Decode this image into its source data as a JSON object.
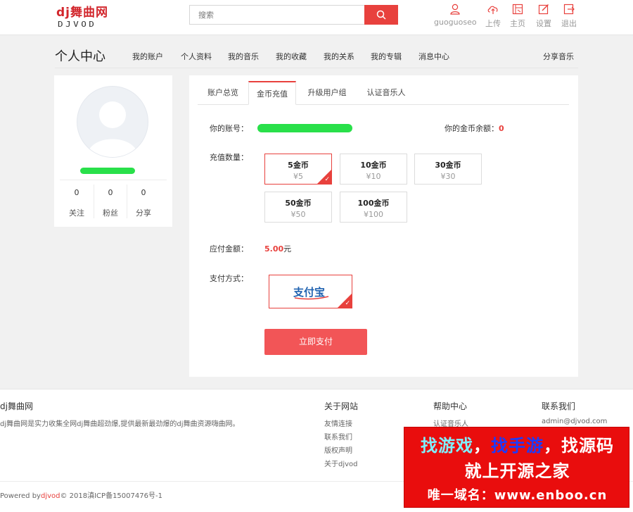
{
  "header": {
    "logo_line1": "dj舞曲网",
    "logo_line2": "DJVOD",
    "search_placeholder": "搜索",
    "username": "guoguoseo",
    "nav": [
      "上传",
      "主页",
      "设置",
      "退出"
    ]
  },
  "page": {
    "title": "个人中心",
    "tabs": [
      "我的账户",
      "个人资料",
      "我的音乐",
      "我的收藏",
      "我的关系",
      "我的专辑",
      "消息中心"
    ],
    "share": "分享音乐"
  },
  "profile": {
    "stats": [
      {
        "value": "0",
        "label": "关注"
      },
      {
        "value": "0",
        "label": "粉丝"
      },
      {
        "value": "0",
        "label": "分享"
      }
    ]
  },
  "panel": {
    "tabs": [
      "账户总览",
      "金币充值",
      "升级用户组",
      "认证音乐人"
    ],
    "active_tab": "金币充值",
    "account_label": "你的账号：",
    "balance_label": "你的金币余额：",
    "balance_value": "0",
    "qty_label": "充值数量：",
    "options": [
      {
        "coins": "5金币",
        "price": "¥5",
        "selected": true
      },
      {
        "coins": "10金币",
        "price": "¥10",
        "selected": false
      },
      {
        "coins": "30金币",
        "price": "¥30",
        "selected": false
      },
      {
        "coins": "50金币",
        "price": "¥50",
        "selected": false
      },
      {
        "coins": "100金币",
        "price": "¥100",
        "selected": false
      }
    ],
    "amount_label": "应付金额：",
    "amount_value": "5.00",
    "amount_unit": "元",
    "payment_label": "支付方式：",
    "payment_method": "支付宝",
    "pay_button": "立即支付"
  },
  "footer": {
    "brand": "dj舞曲网",
    "description": "dj舞曲网是实力收集全网dj舞曲超劲爆,提供最新最劲爆的dj舞曲资源嗨曲网。",
    "about_title": "关于网站",
    "about_links": [
      "友情连接",
      "联系我们",
      "版权声明",
      "关于djvod"
    ],
    "help_title": "帮助中心",
    "help_links": [
      "认证音乐人"
    ],
    "contact_title": "联系我们",
    "contact_email": "admin@djvod.com",
    "copyright_prefix": "Powered by",
    "copyright_link": "djvod",
    "copyright_suffix": "© 2018滇ICP备15007476号-1"
  },
  "ad": {
    "line1_a": "找游戏",
    "line1_b": "，",
    "line1_c": "找手游",
    "line1_d": "，",
    "line1_e": "找源码",
    "line2": "就上开源之家",
    "line3": "唯一域名：www.enboo.cn"
  },
  "colors": {
    "accent": "#e8413d",
    "pay_button": "#f25557",
    "page_bg": "#f1f1f1",
    "redaction_green": "#29e04a"
  }
}
